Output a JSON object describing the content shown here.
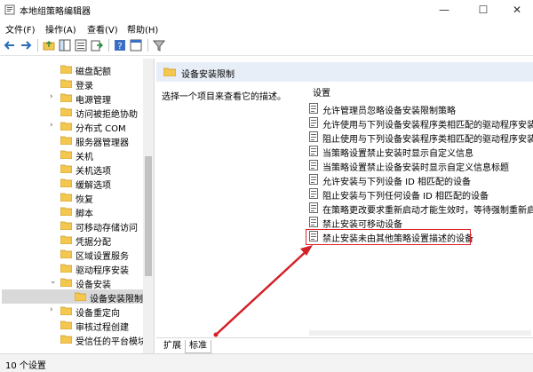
{
  "window": {
    "title": "本地组策略编辑器",
    "controls": {
      "minimize": "—",
      "maximize": "☐",
      "close": "✕"
    }
  },
  "menu": [
    "文件(F)",
    "操作(A)",
    "查看(V)",
    "帮助(H)"
  ],
  "toolbar": {
    "icons": [
      "back-icon",
      "forward-icon",
      "up-folder-icon",
      "show-tree-icon",
      "export-icon",
      "help-icon",
      "properties-icon",
      "filter-icon"
    ]
  },
  "tree": [
    {
      "label": "磁盘配额",
      "twisty": ""
    },
    {
      "label": "登录",
      "twisty": ""
    },
    {
      "label": "电源管理",
      "twisty": "›"
    },
    {
      "label": "访问被拒绝协助",
      "twisty": ""
    },
    {
      "label": "分布式 COM",
      "twisty": "›"
    },
    {
      "label": "服务器管理器",
      "twisty": ""
    },
    {
      "label": "关机",
      "twisty": ""
    },
    {
      "label": "关机选项",
      "twisty": ""
    },
    {
      "label": "缓解选项",
      "twisty": ""
    },
    {
      "label": "恢复",
      "twisty": ""
    },
    {
      "label": "脚本",
      "twisty": ""
    },
    {
      "label": "可移动存储访问",
      "twisty": ""
    },
    {
      "label": "凭据分配",
      "twisty": ""
    },
    {
      "label": "区域设置服务",
      "twisty": ""
    },
    {
      "label": "驱动程序安装",
      "twisty": ""
    },
    {
      "label": "设备安装",
      "twisty": "⌄"
    },
    {
      "label": "设备安装限制",
      "twisty": "",
      "selected": true
    },
    {
      "label": "设备重定向",
      "twisty": "›"
    },
    {
      "label": "审核过程创建",
      "twisty": ""
    },
    {
      "label": "受信任的平台模块",
      "twisty": ""
    }
  ],
  "right_pane": {
    "header": "设备安装限制",
    "description": "选择一个项目来查看它的描述。",
    "column_header": "设置",
    "settings": [
      "允许管理员忽略设备安装限制策略",
      "允许使用与下列设备安装程序类相匹配的驱动程序安装",
      "阻止使用与下列设备安装程序类相匹配的驱动程序安装",
      "当策略设置禁止安装时显示自定义信息",
      "当策略设置禁止设备安装时显示自定义信息标题",
      "允许安装与下列设备 ID 相匹配的设备",
      "阻止安装与下列任何设备 ID 相匹配的设备",
      "在策略更改要求重新启动才能生效时，等待强制重新启",
      "禁止安装可移动设备",
      "禁止安装未由其他策略设置描述的设备"
    ],
    "highlighted_index": 9
  },
  "tabs": [
    "扩展",
    "标准"
  ],
  "status": "10 个设置",
  "colors": {
    "highlight": "#e0242b",
    "header_bg": "#e8eef7",
    "folder": "#f4c74f"
  }
}
